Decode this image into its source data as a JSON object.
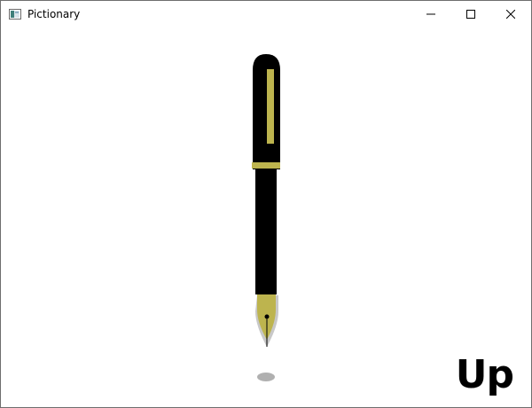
{
  "window": {
    "title": "Pictionary",
    "controls": {
      "minimize_icon": "minimize-icon",
      "maximize_icon": "maximize-icon",
      "close_icon": "close-icon"
    }
  },
  "canvas": {
    "pen_state": "Up",
    "pen": {
      "body_color": "#000000",
      "trim_color": "#bdb44e",
      "nib_shadow_color": "#c8c8c8",
      "shadow_color": "#b0b0b0"
    }
  }
}
